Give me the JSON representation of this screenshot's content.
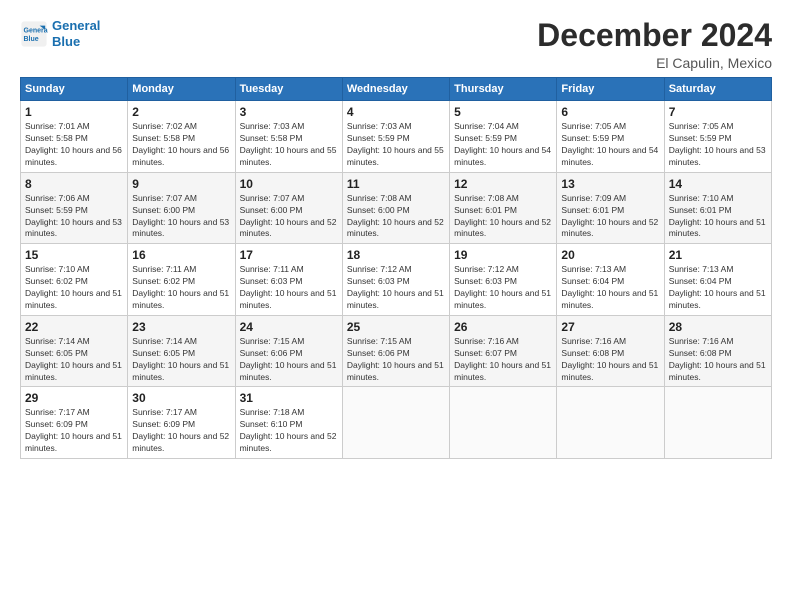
{
  "logo": {
    "line1": "General",
    "line2": "Blue"
  },
  "title": "December 2024",
  "subtitle": "El Capulin, Mexico",
  "days_of_week": [
    "Sunday",
    "Monday",
    "Tuesday",
    "Wednesday",
    "Thursday",
    "Friday",
    "Saturday"
  ],
  "weeks": [
    [
      {
        "day": "1",
        "sunrise": "Sunrise: 7:01 AM",
        "sunset": "Sunset: 5:58 PM",
        "daylight": "Daylight: 10 hours and 56 minutes."
      },
      {
        "day": "2",
        "sunrise": "Sunrise: 7:02 AM",
        "sunset": "Sunset: 5:58 PM",
        "daylight": "Daylight: 10 hours and 56 minutes."
      },
      {
        "day": "3",
        "sunrise": "Sunrise: 7:03 AM",
        "sunset": "Sunset: 5:58 PM",
        "daylight": "Daylight: 10 hours and 55 minutes."
      },
      {
        "day": "4",
        "sunrise": "Sunrise: 7:03 AM",
        "sunset": "Sunset: 5:59 PM",
        "daylight": "Daylight: 10 hours and 55 minutes."
      },
      {
        "day": "5",
        "sunrise": "Sunrise: 7:04 AM",
        "sunset": "Sunset: 5:59 PM",
        "daylight": "Daylight: 10 hours and 54 minutes."
      },
      {
        "day": "6",
        "sunrise": "Sunrise: 7:05 AM",
        "sunset": "Sunset: 5:59 PM",
        "daylight": "Daylight: 10 hours and 54 minutes."
      },
      {
        "day": "7",
        "sunrise": "Sunrise: 7:05 AM",
        "sunset": "Sunset: 5:59 PM",
        "daylight": "Daylight: 10 hours and 53 minutes."
      }
    ],
    [
      {
        "day": "8",
        "sunrise": "Sunrise: 7:06 AM",
        "sunset": "Sunset: 5:59 PM",
        "daylight": "Daylight: 10 hours and 53 minutes."
      },
      {
        "day": "9",
        "sunrise": "Sunrise: 7:07 AM",
        "sunset": "Sunset: 6:00 PM",
        "daylight": "Daylight: 10 hours and 53 minutes."
      },
      {
        "day": "10",
        "sunrise": "Sunrise: 7:07 AM",
        "sunset": "Sunset: 6:00 PM",
        "daylight": "Daylight: 10 hours and 52 minutes."
      },
      {
        "day": "11",
        "sunrise": "Sunrise: 7:08 AM",
        "sunset": "Sunset: 6:00 PM",
        "daylight": "Daylight: 10 hours and 52 minutes."
      },
      {
        "day": "12",
        "sunrise": "Sunrise: 7:08 AM",
        "sunset": "Sunset: 6:01 PM",
        "daylight": "Daylight: 10 hours and 52 minutes."
      },
      {
        "day": "13",
        "sunrise": "Sunrise: 7:09 AM",
        "sunset": "Sunset: 6:01 PM",
        "daylight": "Daylight: 10 hours and 52 minutes."
      },
      {
        "day": "14",
        "sunrise": "Sunrise: 7:10 AM",
        "sunset": "Sunset: 6:01 PM",
        "daylight": "Daylight: 10 hours and 51 minutes."
      }
    ],
    [
      {
        "day": "15",
        "sunrise": "Sunrise: 7:10 AM",
        "sunset": "Sunset: 6:02 PM",
        "daylight": "Daylight: 10 hours and 51 minutes."
      },
      {
        "day": "16",
        "sunrise": "Sunrise: 7:11 AM",
        "sunset": "Sunset: 6:02 PM",
        "daylight": "Daylight: 10 hours and 51 minutes."
      },
      {
        "day": "17",
        "sunrise": "Sunrise: 7:11 AM",
        "sunset": "Sunset: 6:03 PM",
        "daylight": "Daylight: 10 hours and 51 minutes."
      },
      {
        "day": "18",
        "sunrise": "Sunrise: 7:12 AM",
        "sunset": "Sunset: 6:03 PM",
        "daylight": "Daylight: 10 hours and 51 minutes."
      },
      {
        "day": "19",
        "sunrise": "Sunrise: 7:12 AM",
        "sunset": "Sunset: 6:03 PM",
        "daylight": "Daylight: 10 hours and 51 minutes."
      },
      {
        "day": "20",
        "sunrise": "Sunrise: 7:13 AM",
        "sunset": "Sunset: 6:04 PM",
        "daylight": "Daylight: 10 hours and 51 minutes."
      },
      {
        "day": "21",
        "sunrise": "Sunrise: 7:13 AM",
        "sunset": "Sunset: 6:04 PM",
        "daylight": "Daylight: 10 hours and 51 minutes."
      }
    ],
    [
      {
        "day": "22",
        "sunrise": "Sunrise: 7:14 AM",
        "sunset": "Sunset: 6:05 PM",
        "daylight": "Daylight: 10 hours and 51 minutes."
      },
      {
        "day": "23",
        "sunrise": "Sunrise: 7:14 AM",
        "sunset": "Sunset: 6:05 PM",
        "daylight": "Daylight: 10 hours and 51 minutes."
      },
      {
        "day": "24",
        "sunrise": "Sunrise: 7:15 AM",
        "sunset": "Sunset: 6:06 PM",
        "daylight": "Daylight: 10 hours and 51 minutes."
      },
      {
        "day": "25",
        "sunrise": "Sunrise: 7:15 AM",
        "sunset": "Sunset: 6:06 PM",
        "daylight": "Daylight: 10 hours and 51 minutes."
      },
      {
        "day": "26",
        "sunrise": "Sunrise: 7:16 AM",
        "sunset": "Sunset: 6:07 PM",
        "daylight": "Daylight: 10 hours and 51 minutes."
      },
      {
        "day": "27",
        "sunrise": "Sunrise: 7:16 AM",
        "sunset": "Sunset: 6:08 PM",
        "daylight": "Daylight: 10 hours and 51 minutes."
      },
      {
        "day": "28",
        "sunrise": "Sunrise: 7:16 AM",
        "sunset": "Sunset: 6:08 PM",
        "daylight": "Daylight: 10 hours and 51 minutes."
      }
    ],
    [
      {
        "day": "29",
        "sunrise": "Sunrise: 7:17 AM",
        "sunset": "Sunset: 6:09 PM",
        "daylight": "Daylight: 10 hours and 51 minutes."
      },
      {
        "day": "30",
        "sunrise": "Sunrise: 7:17 AM",
        "sunset": "Sunset: 6:09 PM",
        "daylight": "Daylight: 10 hours and 52 minutes."
      },
      {
        "day": "31",
        "sunrise": "Sunrise: 7:18 AM",
        "sunset": "Sunset: 6:10 PM",
        "daylight": "Daylight: 10 hours and 52 minutes."
      },
      null,
      null,
      null,
      null
    ]
  ]
}
